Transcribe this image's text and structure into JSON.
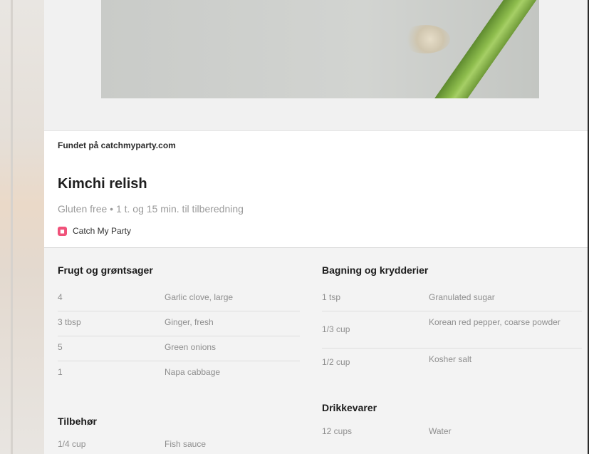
{
  "found_on": "Fundet på catchmyparty.com",
  "recipe": {
    "title": "Kimchi relish",
    "meta": "Gluten free • 1 t. og 15 min. til tilberedning",
    "source": "Catch My Party"
  },
  "groups": {
    "produce": {
      "title": "Frugt og grøntsager",
      "items": [
        {
          "qty": "4",
          "name": "Garlic clove, large"
        },
        {
          "qty": "3 tbsp",
          "name": "Ginger, fresh"
        },
        {
          "qty": "5",
          "name": "Green onions"
        },
        {
          "qty": "1",
          "name": "Napa cabbage"
        }
      ]
    },
    "baking": {
      "title": "Bagning og krydderier",
      "items": [
        {
          "qty": "1 tsp",
          "name": "Granulated sugar"
        },
        {
          "qty": "1/3 cup",
          "name": "Korean red pepper, coarse powder"
        },
        {
          "qty": "1/2 cup",
          "name": "Kosher salt"
        }
      ]
    },
    "drinks": {
      "title": "Drikkevarer",
      "items": [
        {
          "qty": "12 cups",
          "name": "Water"
        }
      ]
    },
    "extras": {
      "title": "Tilbehør",
      "items": [
        {
          "qty": "1/4 cup",
          "name": "Fish sauce"
        }
      ]
    }
  },
  "icons": {
    "source": "catch-my-party-logo-icon"
  }
}
